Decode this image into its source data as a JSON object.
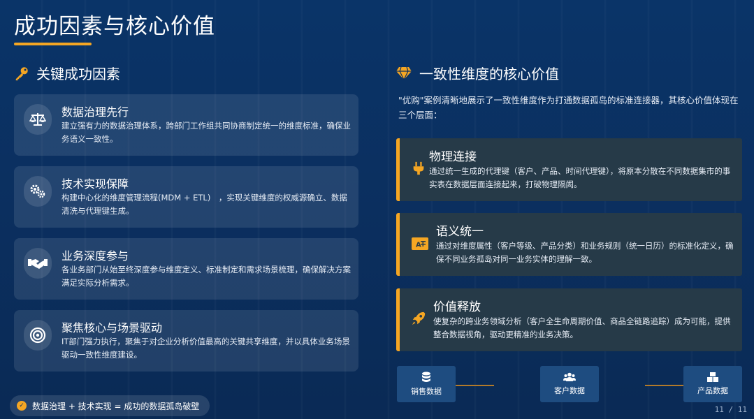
{
  "page": {
    "title": "成功因素与核心价值",
    "page_indicator": "11 / 11"
  },
  "left": {
    "heading": "关键成功因素",
    "heading_icon": "key-icon",
    "cards": [
      {
        "icon": "scale-icon",
        "title": "数据治理先行",
        "desc": "建立强有力的数据治理体系，跨部门工作组共同协商制定统一的维度标准，确保业务语义一致性。"
      },
      {
        "icon": "gears-icon",
        "title": "技术实现保障",
        "desc": "构建中心化的维度管理流程(MDM + ETL)　，实现关键维度的权威源确立、数据清洗与代理键生成。"
      },
      {
        "icon": "handshake-icon",
        "title": "业务深度参与",
        "desc": "各业务部门从始至终深度参与维度定义、标准制定和需求场景梳理，确保解决方案满足实际分析需求。"
      },
      {
        "icon": "target-icon",
        "title": "聚焦核心与场景驱动",
        "desc": "IT部门强力执行，聚焦于对企业分析价值最高的关键共享维度，并以具体业务场景驱动一致性维度建设。"
      }
    ],
    "summary": "数据治理 + 技术实现 = 成功的数据孤岛破壁"
  },
  "right": {
    "heading": "一致性维度的核心价值",
    "heading_icon": "diamond-icon",
    "intro": "\"优购\"案例清晰地展示了一致性维度作为打通数据孤岛的标准连接器，其核心价值体现在三个层面：",
    "values": [
      {
        "icon": "plug-icon",
        "title": "物理连接",
        "desc": "通过统一生成的代理键（客户、产品、时间代理键），将原本分散在不同数据集市的事实表在数据层面连接起来，打破物理隔阂。"
      },
      {
        "icon": "translate-icon",
        "title": "语义统一",
        "desc": "通过对维度属性（客户等级、产品分类）和业务规则（统一日历）的标准化定义，确保不同业务孤岛对同一业务实体的理解一致。"
      },
      {
        "icon": "rocket-icon",
        "title": "价值释放",
        "desc": "使复杂的跨业务领域分析（客户全生命周期价值、商品全链路追踪）成为可能，提供整合数据视角，驱动更精准的业务决策。"
      }
    ],
    "data_boxes": [
      {
        "icon": "database-icon",
        "label": "销售数据"
      },
      {
        "icon": "users-icon",
        "label": "客户数据"
      },
      {
        "icon": "boxes-icon",
        "label": "产品数据"
      }
    ]
  },
  "colors": {
    "accent": "#f5a623",
    "background": "#0b2f5f",
    "card": "#263a48"
  }
}
